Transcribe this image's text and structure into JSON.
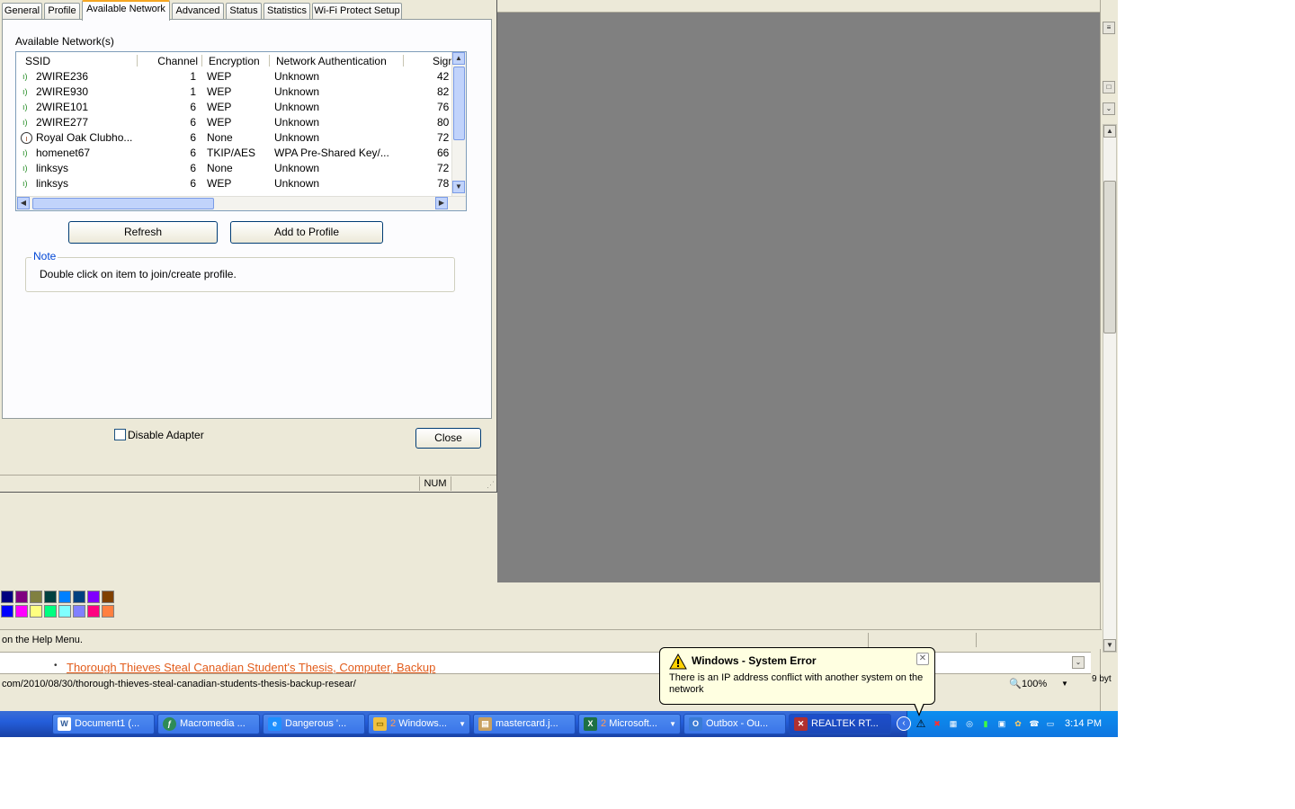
{
  "dialog": {
    "tabs": [
      "General",
      "Profile",
      "Available Network",
      "Advanced",
      "Status",
      "Statistics",
      "Wi-Fi Protect Setup"
    ],
    "active_tab": "Available Network",
    "section_label": "Available Network(s)",
    "columns": [
      "SSID",
      "Channel",
      "Encryption",
      "Network Authentication",
      "Sign"
    ],
    "networks": [
      {
        "ssid": "2WIRE236",
        "channel": "1",
        "encryption": "WEP",
        "auth": "Unknown",
        "signal": "42"
      },
      {
        "ssid": "2WIRE930",
        "channel": "1",
        "encryption": "WEP",
        "auth": "Unknown",
        "signal": "82"
      },
      {
        "ssid": "2WIRE101",
        "channel": "6",
        "encryption": "WEP",
        "auth": "Unknown",
        "signal": "76"
      },
      {
        "ssid": "2WIRE277",
        "channel": "6",
        "encryption": "WEP",
        "auth": "Unknown",
        "signal": "80"
      },
      {
        "ssid": "Royal Oak Clubho...",
        "channel": "6",
        "encryption": "None",
        "auth": "Unknown",
        "signal": "72"
      },
      {
        "ssid": "homenet67",
        "channel": "6",
        "encryption": "TKIP/AES",
        "auth": "WPA Pre-Shared Key/...",
        "signal": "66"
      },
      {
        "ssid": "linksys",
        "channel": "6",
        "encryption": "None",
        "auth": "Unknown",
        "signal": "72"
      },
      {
        "ssid": "linksys",
        "channel": "6",
        "encryption": "WEP",
        "auth": "Unknown",
        "signal": "78"
      }
    ],
    "refresh_label": "Refresh",
    "add_profile_label": "Add to Profile",
    "note_legend": "Note",
    "note_text": "Double click on item to join/create profile.",
    "disable_adapter_label": "Disable Adapter",
    "close_label": "Close",
    "status_num": "NUM"
  },
  "background": {
    "help_status": "on the Help Menu.",
    "article_link": "Thorough Thieves Steal Canadian Student's Thesis, Computer, Backup",
    "url": "com/2010/08/30/thorough-thieves-steal-canadian-students-thesis-backup-resear/",
    "zoom": "100%",
    "right_fragment": "9 byt"
  },
  "balloon": {
    "title": "Windows - System Error",
    "text": "There is an IP address conflict with another system on the network"
  },
  "taskbar": {
    "tasks": [
      {
        "label": "Document1 (...",
        "icon": "word-icon"
      },
      {
        "label": "Macromedia ...",
        "icon": "dreamweaver-icon"
      },
      {
        "label": "Dangerous '...",
        "icon": "ie-icon"
      },
      {
        "count": "2",
        "label": "Windows...",
        "icon": "folder-icon"
      },
      {
        "label": "mastercard.j...",
        "icon": "image-icon"
      },
      {
        "count": "2",
        "label": "Microsoft...",
        "icon": "excel-icon"
      },
      {
        "label": "Outbox - Ou...",
        "icon": "outlook-icon"
      },
      {
        "label": "REALTEK RT...",
        "icon": "realtek-icon"
      }
    ],
    "clock": "3:14 PM"
  },
  "colors": {
    "accent_tab": "#f5a623",
    "link": "#e25c1b",
    "balloon_bg": "#ffffe1",
    "taskbar": "#245edb"
  }
}
